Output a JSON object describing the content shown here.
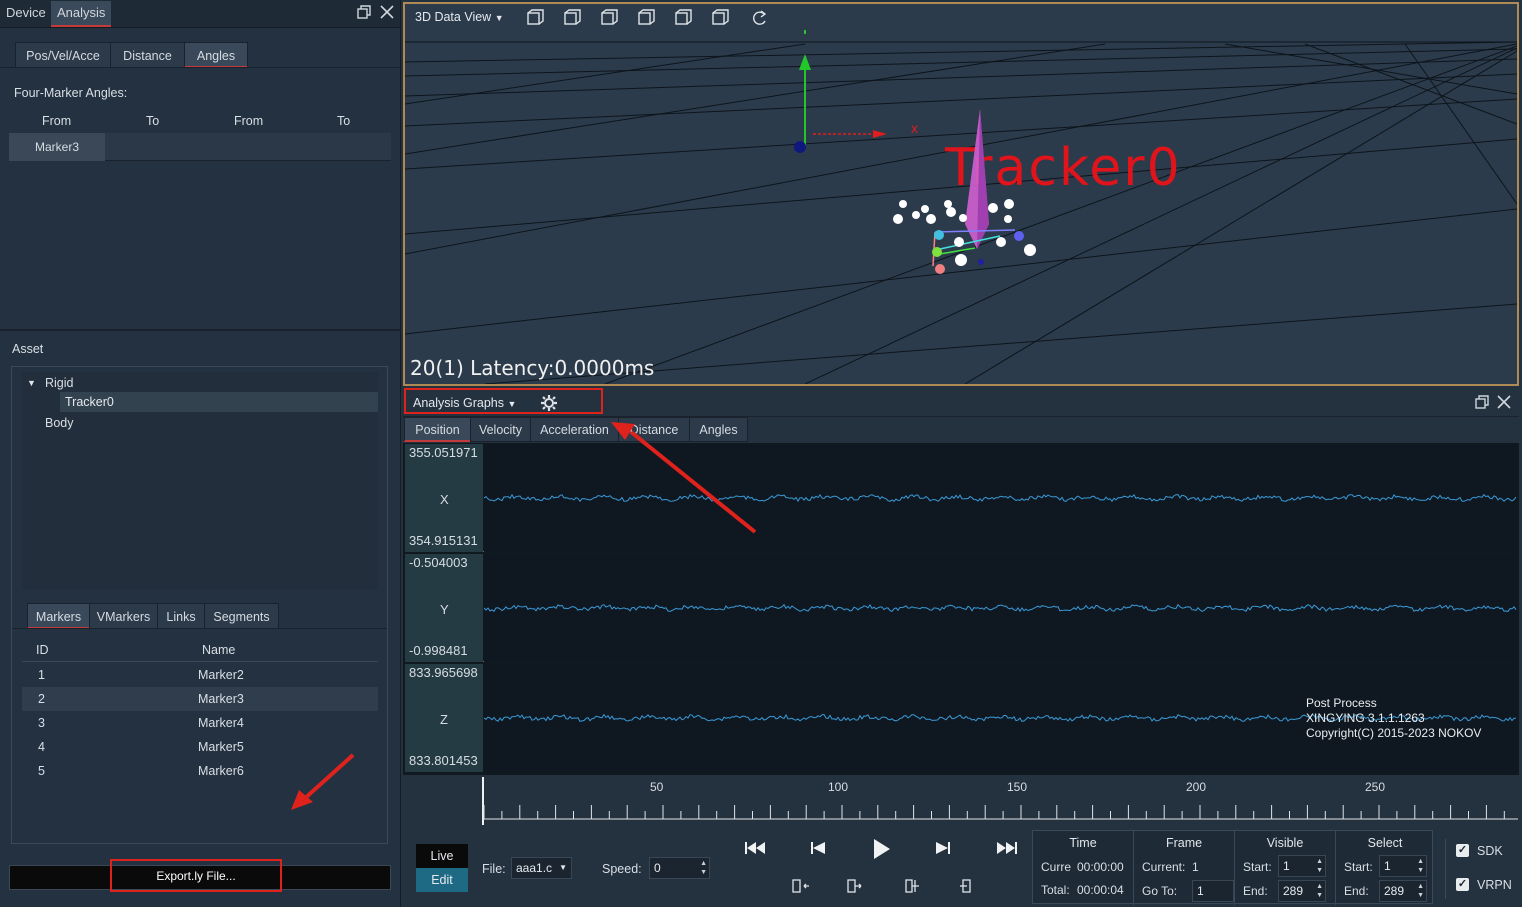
{
  "left_panel": {
    "tabs": [
      "Device",
      "Analysis"
    ],
    "sub_tabs": [
      "Pos/Vel/Acce",
      "Distance",
      "Angles"
    ],
    "four_marker_title": "Four-Marker Angles:",
    "angle_headers": [
      "From",
      "To",
      "From",
      "To"
    ],
    "angle_row_first": "Marker3",
    "asset_title": "Asset",
    "tree": {
      "root": "Rigid",
      "child": "Tracker0",
      "sibling": "Body"
    },
    "marker_tabs": [
      "Markers",
      "VMarkers",
      "Links",
      "Segments"
    ],
    "marker_headers": [
      "ID",
      "Name"
    ],
    "markers": [
      {
        "id": "1",
        "name": "Marker2"
      },
      {
        "id": "2",
        "name": "Marker3"
      },
      {
        "id": "3",
        "name": "Marker4"
      },
      {
        "id": "4",
        "name": "Marker5"
      },
      {
        "id": "5",
        "name": "Marker6"
      }
    ],
    "export_label": "Export.ly File..."
  },
  "viewport": {
    "title": "3D Data View",
    "tracker_label": "Tracker0",
    "axis_x_label": "x",
    "latency_text": "20(1) Latency:0.0000ms"
  },
  "graphs": {
    "title": "Analysis Graphs",
    "tabs": [
      "Position",
      "Velocity",
      "Acceleration",
      "Distance",
      "Angles"
    ],
    "rows": [
      {
        "axis": "X",
        "max": "355.051971",
        "min": "354.915131"
      },
      {
        "axis": "Y",
        "max": "-0.504003",
        "min": "-0.998481"
      },
      {
        "axis": "Z",
        "max": "833.965698",
        "min": "833.801453"
      }
    ],
    "watermark": [
      "Post Process",
      "XINGYING 3.1.1.1263",
      "Copyright(C) 2015-2023 NOKOV"
    ],
    "timeline_ticks": [
      "50",
      "100",
      "150",
      "200",
      "250"
    ]
  },
  "playback": {
    "live_label": "Live",
    "edit_label": "Edit",
    "file_label": "File:",
    "file_value": "aaa1.c",
    "speed_label": "Speed:",
    "speed_value": "0",
    "time_header": "Time",
    "time_current_label": "Curre",
    "time_current": "00:00:00",
    "time_total_label": "Total:",
    "time_total": "00:00:04",
    "frame_header": "Frame",
    "frame_current_label": "Current:",
    "frame_current": "1",
    "goto_label": "Go To:",
    "goto_value": "1",
    "visible_header": "Visible",
    "visible_start_label": "Start:",
    "visible_start": "1",
    "visible_end_label": "End:",
    "visible_end": "289",
    "select_header": "Select",
    "select_start_label": "Start:",
    "select_start": "1",
    "select_end_label": "End:",
    "select_end": "289",
    "sdk_label": "SDK",
    "vrpn_label": "VRPN"
  }
}
